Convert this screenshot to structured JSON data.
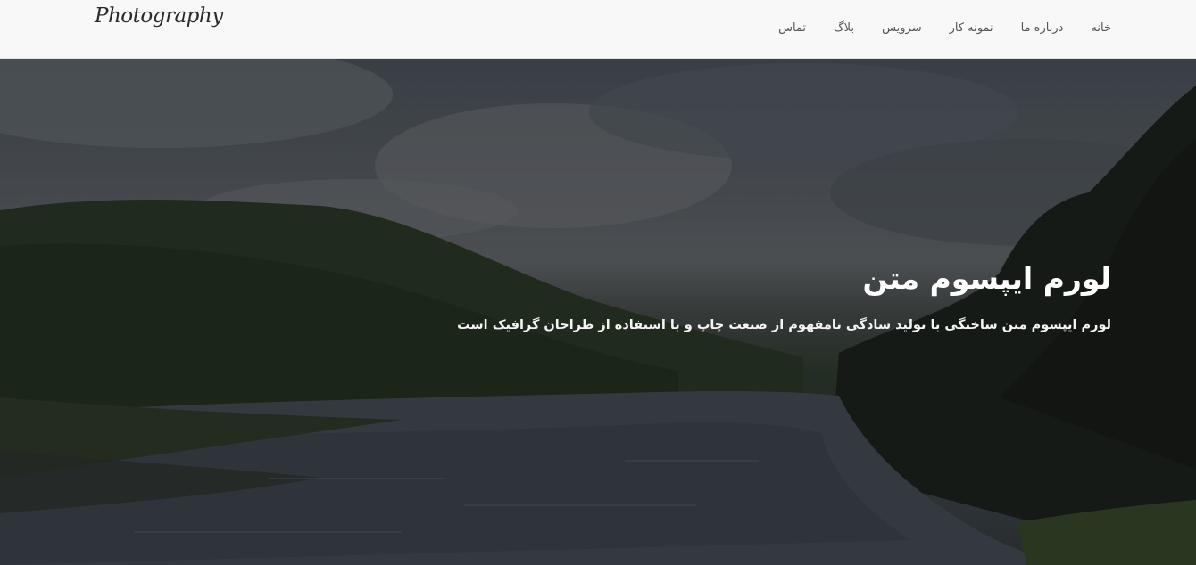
{
  "navbar": {
    "logo": "Photography",
    "links": [
      {
        "label": "تماس"
      },
      {
        "label": "بلاگ"
      },
      {
        "label": "سرویس"
      },
      {
        "label": "نمونه کار"
      },
      {
        "label": "درباره ما"
      },
      {
        "label": "خانه"
      }
    ]
  },
  "hero": {
    "background": "river-landscape-photo",
    "title": "لورم ایپسوم متن",
    "text": "لورم ایپسوم متن ساختگی با تولید سادگی نامفهوم از صنعت چاپ و با استفاده از طراحان گرافیک است"
  }
}
